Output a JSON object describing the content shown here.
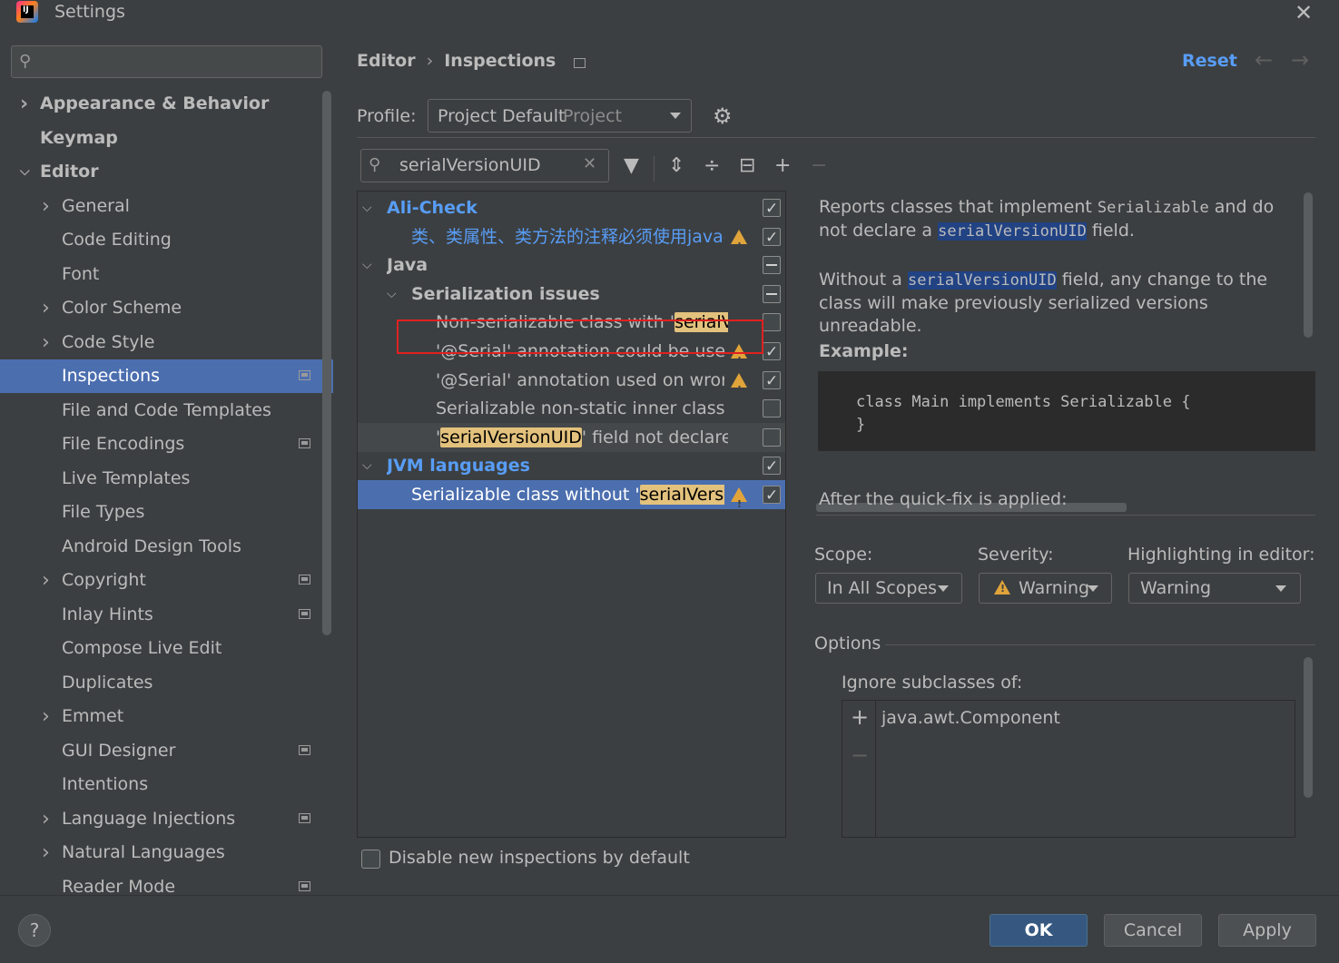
{
  "window": {
    "title": "Settings"
  },
  "sidebar": {
    "search_placeholder": "",
    "items": [
      {
        "label": "Appearance & Behavior",
        "has_arrow": true,
        "expanded": false,
        "level": 0,
        "bold": true,
        "project": false,
        "selected": false
      },
      {
        "label": "Keymap",
        "has_arrow": false,
        "expanded": false,
        "level": 0,
        "bold": true,
        "project": false,
        "selected": false
      },
      {
        "label": "Editor",
        "has_arrow": true,
        "expanded": true,
        "level": 0,
        "bold": true,
        "project": false,
        "selected": false
      },
      {
        "label": "General",
        "has_arrow": true,
        "expanded": false,
        "level": 1,
        "bold": false,
        "project": false,
        "selected": false
      },
      {
        "label": "Code Editing",
        "has_arrow": false,
        "expanded": false,
        "level": 1,
        "bold": false,
        "project": false,
        "selected": false
      },
      {
        "label": "Font",
        "has_arrow": false,
        "expanded": false,
        "level": 1,
        "bold": false,
        "project": false,
        "selected": false
      },
      {
        "label": "Color Scheme",
        "has_arrow": true,
        "expanded": false,
        "level": 1,
        "bold": false,
        "project": false,
        "selected": false
      },
      {
        "label": "Code Style",
        "has_arrow": true,
        "expanded": false,
        "level": 1,
        "bold": false,
        "project": false,
        "selected": false
      },
      {
        "label": "Inspections",
        "has_arrow": false,
        "expanded": false,
        "level": 1,
        "bold": false,
        "project": true,
        "selected": true
      },
      {
        "label": "File and Code Templates",
        "has_arrow": false,
        "expanded": false,
        "level": 1,
        "bold": false,
        "project": false,
        "selected": false
      },
      {
        "label": "File Encodings",
        "has_arrow": false,
        "expanded": false,
        "level": 1,
        "bold": false,
        "project": true,
        "selected": false
      },
      {
        "label": "Live Templates",
        "has_arrow": false,
        "expanded": false,
        "level": 1,
        "bold": false,
        "project": false,
        "selected": false
      },
      {
        "label": "File Types",
        "has_arrow": false,
        "expanded": false,
        "level": 1,
        "bold": false,
        "project": false,
        "selected": false
      },
      {
        "label": "Android Design Tools",
        "has_arrow": false,
        "expanded": false,
        "level": 1,
        "bold": false,
        "project": false,
        "selected": false
      },
      {
        "label": "Copyright",
        "has_arrow": true,
        "expanded": false,
        "level": 1,
        "bold": false,
        "project": true,
        "selected": false
      },
      {
        "label": "Inlay Hints",
        "has_arrow": false,
        "expanded": false,
        "level": 1,
        "bold": false,
        "project": true,
        "selected": false
      },
      {
        "label": "Compose Live Edit",
        "has_arrow": false,
        "expanded": false,
        "level": 1,
        "bold": false,
        "project": false,
        "selected": false
      },
      {
        "label": "Duplicates",
        "has_arrow": false,
        "expanded": false,
        "level": 1,
        "bold": false,
        "project": false,
        "selected": false
      },
      {
        "label": "Emmet",
        "has_arrow": true,
        "expanded": false,
        "level": 1,
        "bold": false,
        "project": false,
        "selected": false
      },
      {
        "label": "GUI Designer",
        "has_arrow": false,
        "expanded": false,
        "level": 1,
        "bold": false,
        "project": true,
        "selected": false
      },
      {
        "label": "Intentions",
        "has_arrow": false,
        "expanded": false,
        "level": 1,
        "bold": false,
        "project": false,
        "selected": false
      },
      {
        "label": "Language Injections",
        "has_arrow": true,
        "expanded": false,
        "level": 1,
        "bold": false,
        "project": true,
        "selected": false
      },
      {
        "label": "Natural Languages",
        "has_arrow": true,
        "expanded": false,
        "level": 1,
        "bold": false,
        "project": false,
        "selected": false
      },
      {
        "label": "Reader Mode",
        "has_arrow": false,
        "expanded": false,
        "level": 1,
        "bold": false,
        "project": true,
        "selected": false
      }
    ]
  },
  "header": {
    "breadcrumb": [
      "Editor",
      "Inspections"
    ],
    "reset_label": "Reset",
    "back_icon": "arrow-left-icon",
    "forward_icon": "arrow-right-icon"
  },
  "profile": {
    "label": "Profile:",
    "value": "Project Default",
    "scope": "Project"
  },
  "filter": {
    "value": "serialVersionUID"
  },
  "tree": {
    "rows": [
      {
        "level": 0,
        "arrow": true,
        "pre": "Ali-Check",
        "hl": "",
        "post": "",
        "style": "blue-bold",
        "warn": false,
        "check": "checked",
        "state": ""
      },
      {
        "level": 1,
        "arrow": false,
        "pre": "类、类属性、类方法的注释必须使用javado",
        "hl": "",
        "post": "",
        "style": "blue",
        "warn": true,
        "check": "checked",
        "state": ""
      },
      {
        "level": 0,
        "arrow": true,
        "pre": "Java",
        "hl": "",
        "post": "",
        "style": "bold",
        "warn": false,
        "check": "partial",
        "state": ""
      },
      {
        "level": 1,
        "arrow": true,
        "pre": "Serialization issues",
        "hl": "",
        "post": "",
        "style": "bold",
        "warn": false,
        "check": "partial",
        "state": ""
      },
      {
        "level": 2,
        "arrow": false,
        "pre": "Non-serializable class with '",
        "hl": "serialVers",
        "post": "",
        "style": "",
        "warn": false,
        "check": "unchecked",
        "state": ""
      },
      {
        "level": 2,
        "arrow": false,
        "pre": "'@Serial' annotation could be used",
        "hl": "",
        "post": "",
        "style": "",
        "warn": true,
        "check": "checked",
        "state": ""
      },
      {
        "level": 2,
        "arrow": false,
        "pre": "'@Serial' annotation used on wrong r",
        "hl": "",
        "post": "",
        "style": "",
        "warn": true,
        "check": "checked",
        "state": ""
      },
      {
        "level": 2,
        "arrow": false,
        "pre": "Serializable non-static inner class witl",
        "hl": "",
        "post": "",
        "style": "",
        "warn": false,
        "check": "unchecked",
        "state": ""
      },
      {
        "level": 2,
        "arrow": false,
        "pre": "'",
        "hl": "serialVersionUID",
        "post": "' field not declared '",
        "style": "",
        "warn": false,
        "check": "unchecked",
        "state": "hover"
      },
      {
        "level": 0,
        "arrow": true,
        "pre": "JVM languages",
        "hl": "",
        "post": "",
        "style": "blue-bold",
        "warn": false,
        "check": "checked",
        "state": ""
      },
      {
        "level": 1,
        "arrow": false,
        "pre": "Serializable class without '",
        "hl": "serialVersionU",
        "post": "",
        "style": "",
        "warn": true,
        "check": "checked",
        "state": "sel"
      }
    ]
  },
  "disable_new": {
    "label": "Disable new inspections by default",
    "checked": false
  },
  "description": {
    "p1_a": "Reports classes that implement ",
    "p1_code": "Serializable",
    "p1_b": " and do not declare a ",
    "p1_hl": "serialVersionUID",
    "p1_c": " field.",
    "p2_a": "Without a ",
    "p2_hl": "serialVersionUID",
    "p2_b": " field, any change to the class will make previously serialized versions unreadable.",
    "example_label": "Example:",
    "code": "class Main implements Serializable {\n}",
    "after_label": "After the quick-fix is applied:"
  },
  "settings": {
    "scope_label": "Scope:",
    "scope_value": "In All Scopes",
    "severity_label": "Severity:",
    "severity_value": "Warning",
    "highlight_label": "Highlighting in editor:",
    "highlight_value": "Warning"
  },
  "options": {
    "label": "Options",
    "ignore_label": "Ignore subclasses of:",
    "items": [
      "java.awt.Component"
    ]
  },
  "buttons": {
    "help": "?",
    "ok": "OK",
    "cancel": "Cancel",
    "apply": "Apply"
  },
  "colors": {
    "accent": "#4b6eaf",
    "link": "#589df6",
    "match_highlight": "#e3c27d",
    "warning": "#e0a43a",
    "annotation_box": "#e02020"
  }
}
